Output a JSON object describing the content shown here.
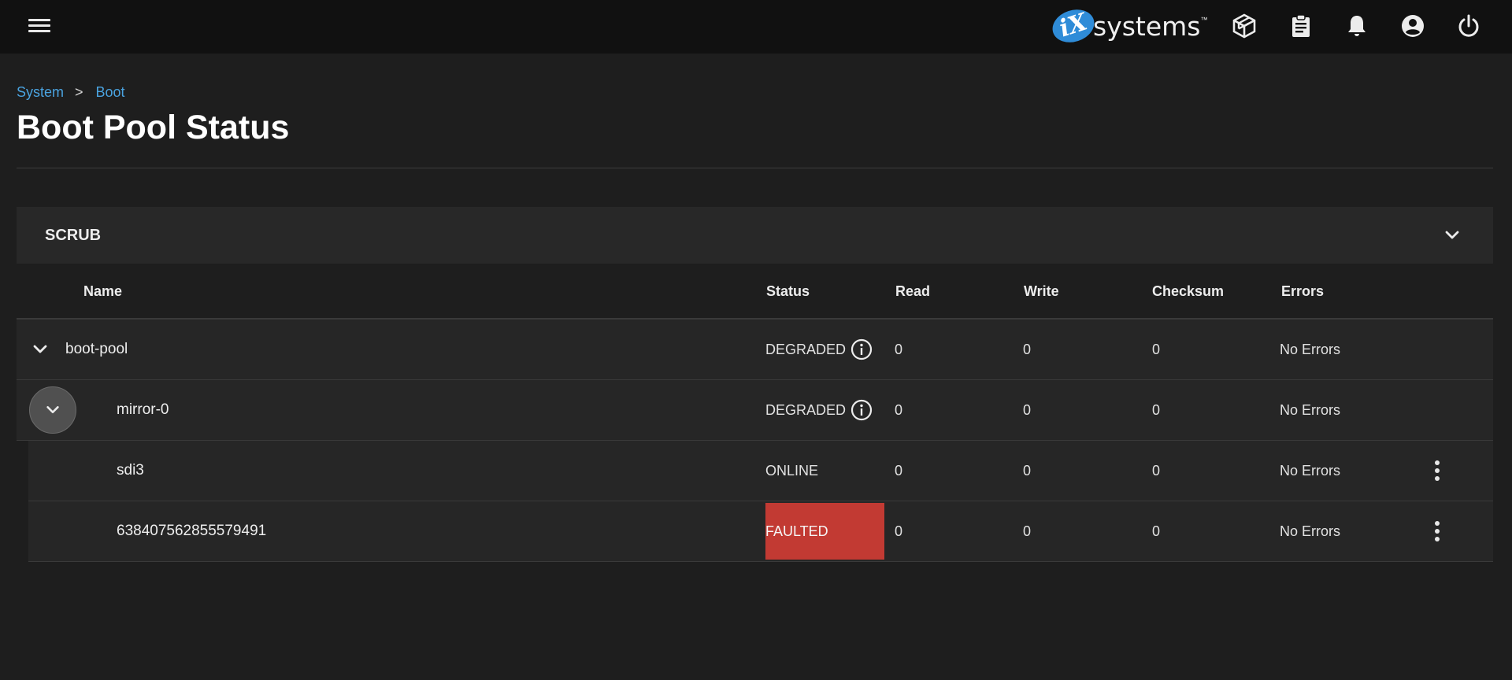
{
  "topbar": {
    "menu_icon": "menu-icon",
    "logo": {
      "mark": "iX",
      "text": "systems",
      "tm": "™"
    },
    "icons": [
      "truecommand-icon",
      "clipboard-icon",
      "bell-icon",
      "account-circle-icon",
      "power-icon"
    ]
  },
  "breadcrumb": {
    "items": [
      "System",
      "Boot"
    ],
    "separator": ">"
  },
  "page": {
    "title": "Boot Pool Status"
  },
  "scrub": {
    "label": "SCRUB"
  },
  "table": {
    "columns": [
      "Name",
      "Status",
      "Read",
      "Write",
      "Checksum",
      "Errors"
    ],
    "rows": [
      {
        "name": "boot-pool",
        "status": "DEGRADED",
        "read": "0",
        "write": "0",
        "checksum": "0",
        "errors": "No Errors"
      },
      {
        "name": "mirror-0",
        "status": "DEGRADED",
        "read": "0",
        "write": "0",
        "checksum": "0",
        "errors": "No Errors"
      },
      {
        "name": "sdi3",
        "status": "ONLINE",
        "read": "0",
        "write": "0",
        "checksum": "0",
        "errors": "No Errors"
      },
      {
        "name": "638407562855579491",
        "status": "FAULTED",
        "read": "0",
        "write": "0",
        "checksum": "0",
        "errors": "No Errors"
      }
    ]
  },
  "colors": {
    "topbar_bg": "#111111",
    "page_bg": "#1e1e1e",
    "accent_link": "#4aa3e0",
    "faulted": "#c23a33",
    "logo_blue": "#2f8cd8"
  }
}
